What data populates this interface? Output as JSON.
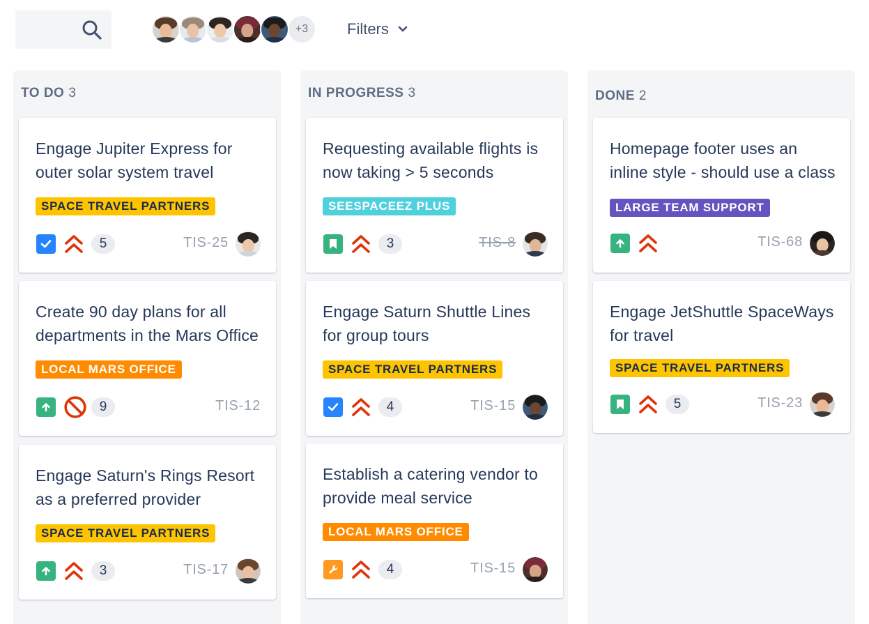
{
  "toolbar": {
    "search_icon": "search-icon",
    "avatars_more": "+3",
    "filters_label": "Filters",
    "filters_icon": "chevron-down-icon"
  },
  "columns": [
    {
      "name": "TO DO",
      "count": "3",
      "cards": [
        {
          "title": "Engage Jupiter Express for outer solar system travel",
          "label": "SPACE TRAVEL PARTNERS",
          "label_color": "#ffc400",
          "type": "checkbox-icon",
          "priority": "highest-priority-icon",
          "points": "5",
          "key": "TIS-25"
        },
        {
          "title": "Create 90 day plans for all departments in the Mars Office",
          "label": "LOCAL MARS OFFICE",
          "label_color": "#ff8b00",
          "type": "improvement-icon",
          "priority": "blocker-icon",
          "points": "9",
          "key": "TIS-12"
        },
        {
          "title": "Engage Saturn's Rings Resort as a preferred provider",
          "label": "SPACE TRAVEL PARTNERS",
          "label_color": "#ffc400",
          "type": "improvement-icon",
          "priority": "highest-priority-icon",
          "points": "3",
          "key": "TIS-17"
        }
      ]
    },
    {
      "name": "IN PROGRESS",
      "count": "3",
      "cards": [
        {
          "title": "Requesting available flights is now taking > 5 seconds",
          "label": "SEESPACEEZ PLUS",
          "label_color": "#4fd1dd",
          "type": "story-icon",
          "priority": "highest-priority-icon",
          "points": "3",
          "key": "TIS-8"
        },
        {
          "title": "Engage Saturn Shuttle Lines for group tours",
          "label": "SPACE TRAVEL PARTNERS",
          "label_color": "#ffc400",
          "type": "checkbox-icon",
          "priority": "highest-priority-icon",
          "points": "4",
          "key": "TIS-15"
        },
        {
          "title": "Establish a catering vendor to provide meal service",
          "label": "LOCAL MARS OFFICE",
          "label_color": "#ff8b00",
          "type": "wrench-icon",
          "priority": "highest-priority-icon",
          "points": "4",
          "key": "TIS-15"
        }
      ]
    },
    {
      "name": "DONE",
      "count": "2",
      "cards": [
        {
          "title": "Homepage footer uses an inline style - should use a class",
          "label": "LARGE TEAM SUPPORT",
          "label_color": "#6554c0",
          "type": "improvement-icon",
          "priority": "highest-priority-icon",
          "points": "",
          "key": "TIS-68"
        },
        {
          "title": "Engage JetShuttle SpaceWays for travel",
          "label": "SPACE TRAVEL PARTNERS",
          "label_color": "#ffc400",
          "type": "story-icon",
          "priority": "highest-priority-icon",
          "points": "5",
          "key": "TIS-23"
        }
      ]
    }
  ],
  "colors": {
    "column_bg": "#f4f5f7",
    "card_bg": "#ffffff",
    "text": "#253858",
    "muted": "#97a0af",
    "priority_red": "#de350b",
    "checkbox_blue": "#2684ff",
    "story_green": "#36b37e",
    "wrench_orange": "#ff991f"
  }
}
